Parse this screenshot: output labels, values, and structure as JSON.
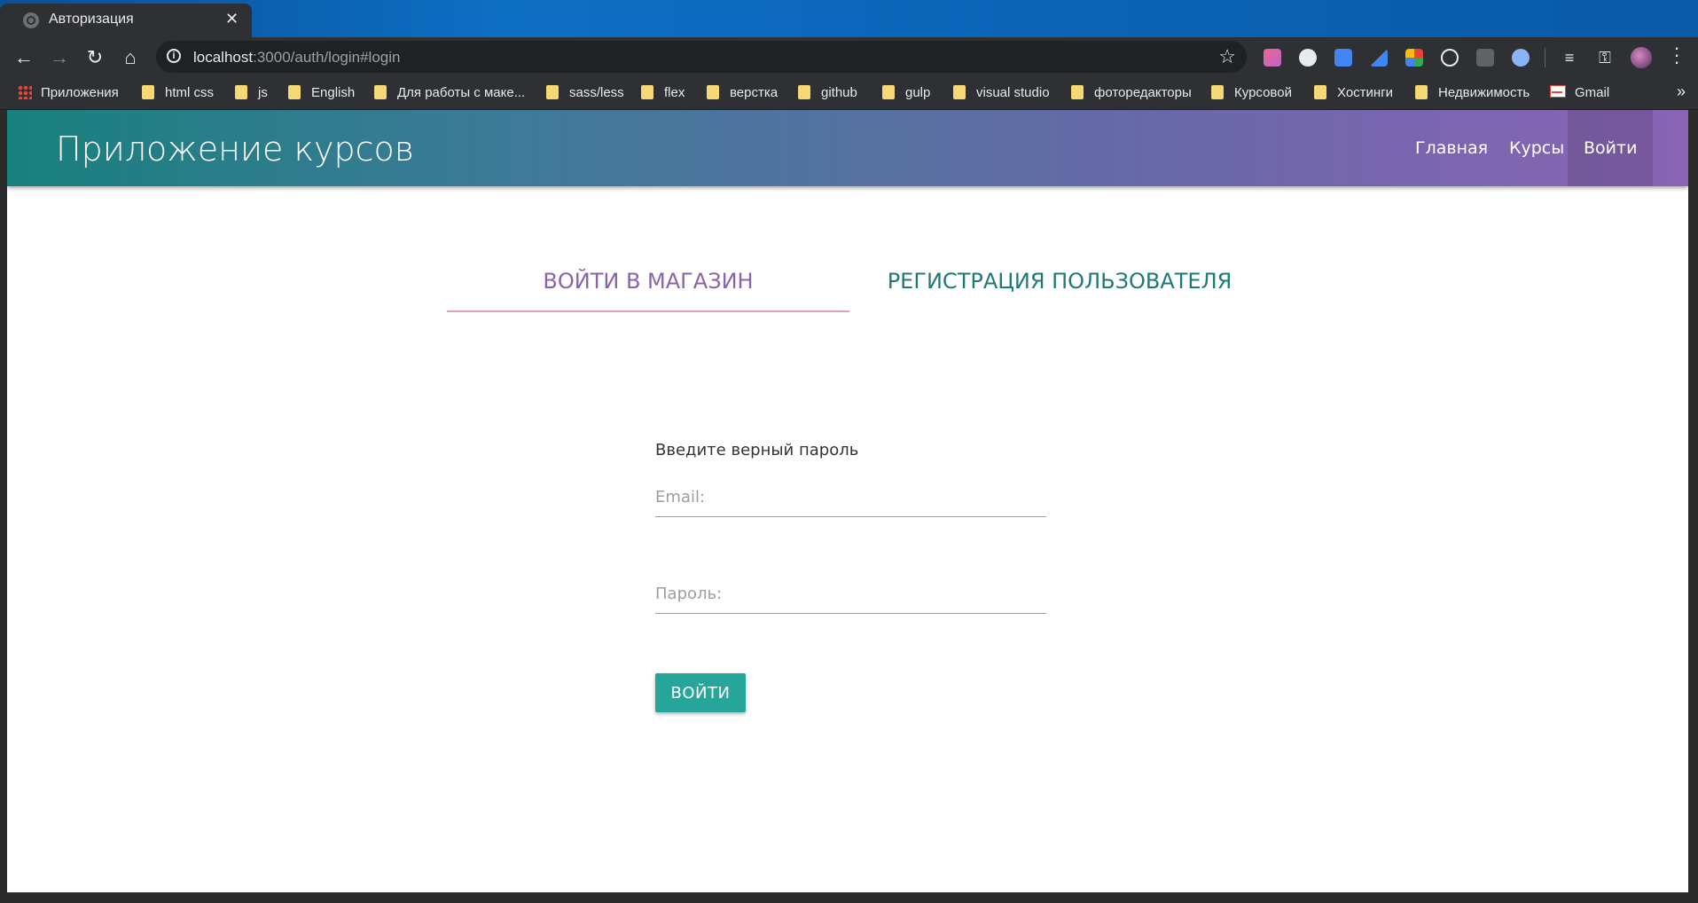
{
  "browser": {
    "tab_title": "Авторизация",
    "tab_close": "✕",
    "url_host": "localhost",
    "url_rest": ":3000/auth/login#login",
    "bookmarks": [
      "Приложения",
      "html css",
      "js",
      "English",
      "Для работы с маке...",
      "sass/less",
      "flex",
      "верстка",
      "github",
      "gulp",
      "visual studio",
      "фоторедакторы",
      "Курсовой",
      "Хостинги",
      "Недвижимость",
      "Gmail"
    ],
    "more_bookmarks": "»"
  },
  "app": {
    "brand": "Приложение курсов",
    "nav": [
      "Главная",
      "Курсы",
      "Войти"
    ]
  },
  "auth": {
    "tab_login": "ВОЙТИ В МАГАЗИН",
    "tab_register": "РЕГИСТРАЦИЯ ПОЛЬЗОВАТЕЛЯ",
    "message": "Введите верный пароль",
    "email_placeholder": "Email:",
    "password_placeholder": "Пароль:",
    "submit_label": "ВОЙТИ"
  }
}
